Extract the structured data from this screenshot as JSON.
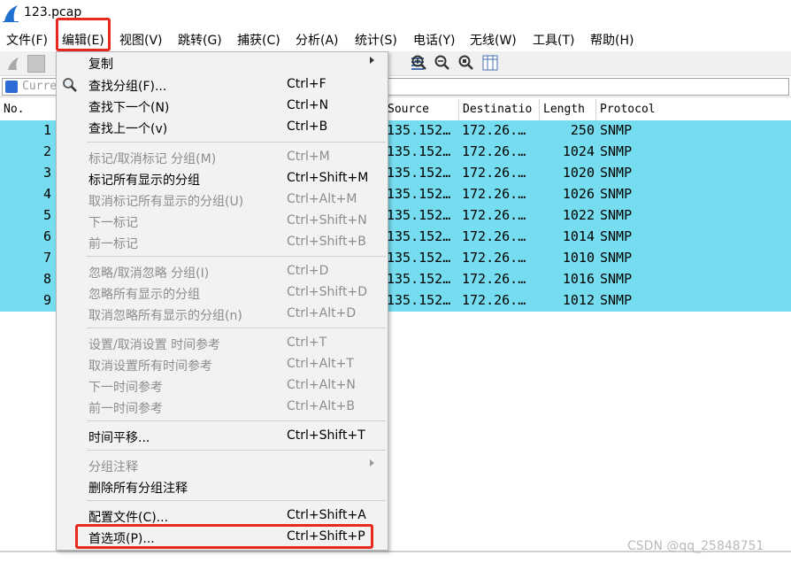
{
  "window": {
    "title": "123.pcap"
  },
  "menubar": {
    "items": [
      "文件(F)",
      "编辑(E)",
      "视图(V)",
      "跳转(G)",
      "捕获(C)",
      "分析(A)",
      "统计(S)",
      "电话(Y)",
      "无线(W)",
      "工具(T)",
      "帮助(H)"
    ]
  },
  "filter": {
    "text": "Curre"
  },
  "packet_list": {
    "columns": [
      "No.",
      "Source",
      "Destinatio",
      "Length",
      "Protocol"
    ],
    "rows": [
      {
        "no": "1",
        "source": "135.152…",
        "destination": "172.26.…",
        "length": "250",
        "protocol": "SNMP"
      },
      {
        "no": "2",
        "source": "135.152…",
        "destination": "172.26.…",
        "length": "1024",
        "protocol": "SNMP"
      },
      {
        "no": "3",
        "source": "135.152…",
        "destination": "172.26.…",
        "length": "1020",
        "protocol": "SNMP"
      },
      {
        "no": "4",
        "source": "135.152…",
        "destination": "172.26.…",
        "length": "1026",
        "protocol": "SNMP"
      },
      {
        "no": "5",
        "source": "135.152…",
        "destination": "172.26.…",
        "length": "1022",
        "protocol": "SNMP"
      },
      {
        "no": "6",
        "source": "135.152…",
        "destination": "172.26.…",
        "length": "1014",
        "protocol": "SNMP"
      },
      {
        "no": "7",
        "source": "135.152…",
        "destination": "172.26.…",
        "length": "1010",
        "protocol": "SNMP"
      },
      {
        "no": "8",
        "source": "135.152…",
        "destination": "172.26.…",
        "length": "1016",
        "protocol": "SNMP"
      },
      {
        "no": "9",
        "source": "135.152…",
        "destination": "172.26.…",
        "length": "1012",
        "protocol": "SNMP"
      }
    ],
    "row_color": "#76dcef"
  },
  "edit_menu": {
    "items": [
      {
        "label": "复制",
        "shortcut": "",
        "submenu": true,
        "enabled": true
      },
      {
        "label": "查找分组(F)...",
        "shortcut": "Ctrl+F",
        "enabled": true,
        "icon": "search-icon"
      },
      {
        "label": "查找下一个(N)",
        "shortcut": "Ctrl+N",
        "enabled": true
      },
      {
        "label": "查找上一个(v)",
        "shortcut": "Ctrl+B",
        "enabled": true
      },
      {
        "label": "标记/取消标记 分组(M)",
        "shortcut": "Ctrl+M",
        "enabled": false
      },
      {
        "label": "标记所有显示的分组",
        "shortcut": "Ctrl+Shift+M",
        "enabled": true
      },
      {
        "label": "取消标记所有显示的分组(U)",
        "shortcut": "Ctrl+Alt+M",
        "enabled": false
      },
      {
        "label": "下一标记",
        "shortcut": "Ctrl+Shift+N",
        "enabled": false
      },
      {
        "label": "前一标记",
        "shortcut": "Ctrl+Shift+B",
        "enabled": false
      },
      {
        "label": "忽略/取消忽略 分组(I)",
        "shortcut": "Ctrl+D",
        "enabled": false
      },
      {
        "label": "忽略所有显示的分组",
        "shortcut": "Ctrl+Shift+D",
        "enabled": false
      },
      {
        "label": "取消忽略所有显示的分组(n)",
        "shortcut": "Ctrl+Alt+D",
        "enabled": false
      },
      {
        "label": "设置/取消设置 时间参考",
        "shortcut": "Ctrl+T",
        "enabled": false
      },
      {
        "label": "取消设置所有时间参考",
        "shortcut": "Ctrl+Alt+T",
        "enabled": false
      },
      {
        "label": "下一时间参考",
        "shortcut": "Ctrl+Alt+N",
        "enabled": false
      },
      {
        "label": "前一时间参考",
        "shortcut": "Ctrl+Alt+B",
        "enabled": false
      },
      {
        "label": "时间平移...",
        "shortcut": "Ctrl+Shift+T",
        "enabled": true
      },
      {
        "label": "分组注释",
        "shortcut": "",
        "submenu": true,
        "enabled": false
      },
      {
        "label": "删除所有分组注释",
        "shortcut": "",
        "enabled": true
      },
      {
        "label": "配置文件(C)...",
        "shortcut": "Ctrl+Shift+A",
        "enabled": true
      },
      {
        "label": "首选项(P)...",
        "shortcut": "Ctrl+Shift+P",
        "enabled": true
      }
    ]
  },
  "highlight_color": "#e8291d",
  "watermark": "CSDN @qq_25848751"
}
